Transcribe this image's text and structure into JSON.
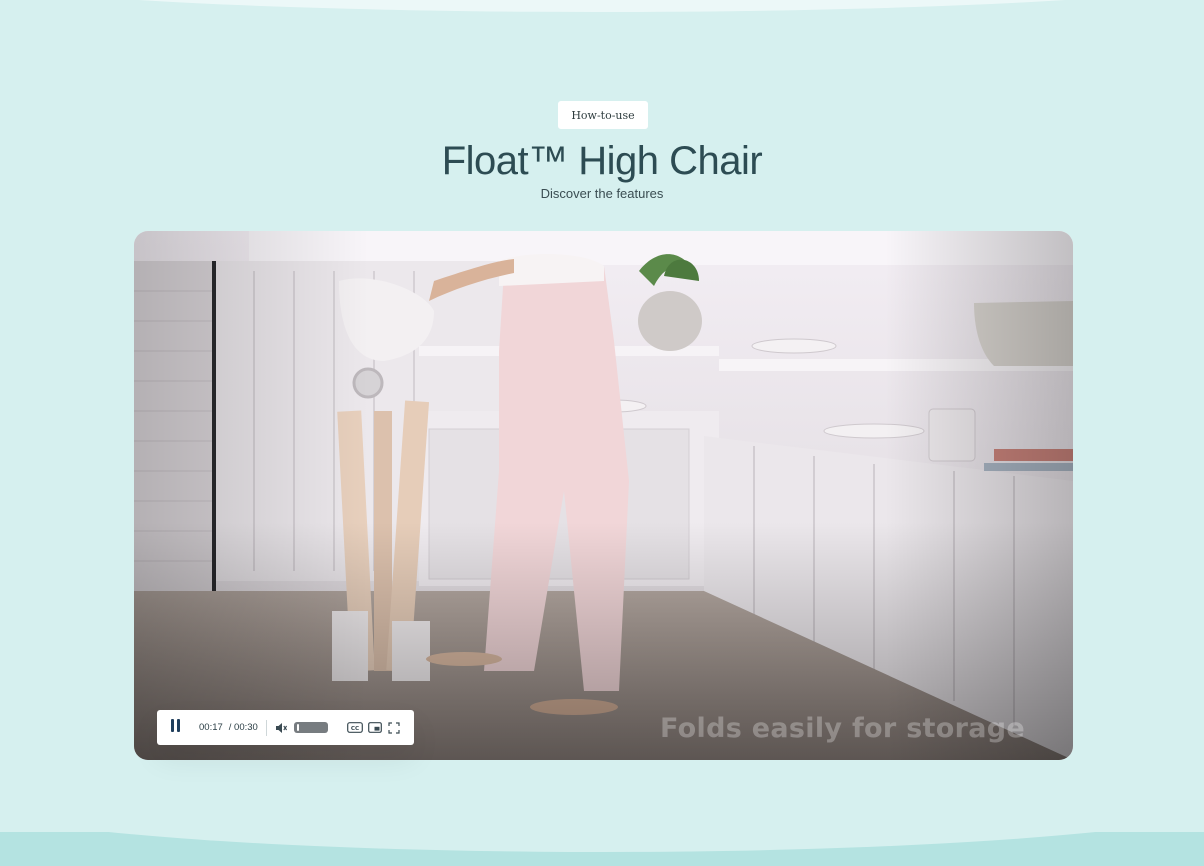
{
  "header": {
    "tag_label": "How-to-use",
    "title": "Float™ High Chair",
    "subtitle": "Discover the features"
  },
  "video": {
    "caption": "Folds easily for storage",
    "current_time": "00:17",
    "duration": "/ 00:30",
    "playing": true,
    "progress": 0.567,
    "volume_level": 0.1
  },
  "colors": {
    "background": "#d6f0ef",
    "title": "#2d4c53",
    "pause_icon": "#1f3e5c",
    "volume_track": "#777c80"
  },
  "icons": [
    "pause-icon",
    "speaker-muted-icon",
    "closed-captions-icon",
    "picture-in-picture-icon",
    "fullscreen-icon"
  ]
}
